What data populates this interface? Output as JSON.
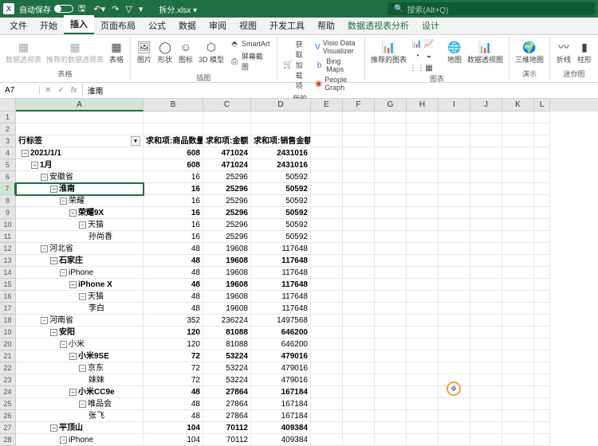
{
  "title_bar": {
    "autosave_label": "自动保存",
    "filename": "拆分.xlsx ▾",
    "search_placeholder": "搜索(Alt+Q)"
  },
  "tabs": [
    "文件",
    "开始",
    "插入",
    "页面布局",
    "公式",
    "数据",
    "审阅",
    "视图",
    "开发工具",
    "帮助",
    "数据透视表分析",
    "设计"
  ],
  "active_tab": "插入",
  "context_tabs": [
    "数据透视表分析",
    "设计"
  ],
  "ribbon": {
    "group_tables": {
      "label": "表格",
      "pivot": "数据透视表",
      "recommend": "推荐的数据透视表",
      "table": "表格"
    },
    "group_illus": {
      "label": "插图",
      "pic": "图片",
      "shapes": "形状",
      "icons": "图标",
      "model": "3D 模型",
      "smartart": "SmartArt",
      "screenshot": "屏幕截图"
    },
    "group_addin": {
      "label": "加载项",
      "get": "获取加载项",
      "my": "我的加载项",
      "visio": "Visio Data Visualizer",
      "bing": "Bing Maps",
      "people": "People Graph"
    },
    "group_charts": {
      "label": "图表",
      "recommend": "推荐的图表",
      "maps": "地图",
      "pivotchart": "数据透视图"
    },
    "group_tour": {
      "label": "演示",
      "map3d": "三维地图"
    },
    "group_spark": {
      "label": "迷你图",
      "line": "折线",
      "col": "柱形"
    }
  },
  "formula_bar": {
    "name_box": "A7",
    "formula": "淮南"
  },
  "columns": [
    "A",
    "B",
    "C",
    "D",
    "E",
    "F",
    "G",
    "H",
    "I",
    "J",
    "K",
    "L"
  ],
  "pivot_headers": {
    "row_label": "行标签",
    "c1": "求和项:商品数量",
    "c2": "求和项:金额",
    "c3": "求和项:销售金额"
  },
  "chart_data": {
    "type": "table",
    "columns": [
      "行标签",
      "求和项:商品数量",
      "求和项:金额",
      "求和项:销售金额"
    ],
    "rows": [
      {
        "label": "2021/1/1",
        "indent": 0,
        "bold": true,
        "v": [
          608,
          471024,
          2431016
        ]
      },
      {
        "label": "1月",
        "indent": 1,
        "bold": true,
        "v": [
          608,
          471024,
          2431016
        ]
      },
      {
        "label": "安徽省",
        "indent": 2,
        "bold": false,
        "v": [
          16,
          25296,
          50592
        ]
      },
      {
        "label": "淮南",
        "indent": 3,
        "bold": true,
        "active": true,
        "v": [
          16,
          25296,
          50592
        ]
      },
      {
        "label": "荣耀",
        "indent": 4,
        "bold": false,
        "v": [
          16,
          25296,
          50592
        ]
      },
      {
        "label": "荣耀9X",
        "indent": 5,
        "bold": true,
        "v": [
          16,
          25296,
          50592
        ]
      },
      {
        "label": "天猫",
        "indent": 6,
        "bold": false,
        "v": [
          16,
          25296,
          50592
        ]
      },
      {
        "label": "孙尚香",
        "indent": 7,
        "bold": false,
        "noexpand": true,
        "v": [
          16,
          25296,
          50592
        ]
      },
      {
        "label": "河北省",
        "indent": 2,
        "bold": false,
        "v": [
          48,
          19608,
          117648
        ]
      },
      {
        "label": "石家庄",
        "indent": 3,
        "bold": true,
        "v": [
          48,
          19608,
          117648
        ]
      },
      {
        "label": "iPhone",
        "indent": 4,
        "bold": false,
        "v": [
          48,
          19608,
          117648
        ]
      },
      {
        "label": "iPhone X",
        "indent": 5,
        "bold": true,
        "v": [
          48,
          19608,
          117648
        ]
      },
      {
        "label": "天猫",
        "indent": 6,
        "bold": false,
        "v": [
          48,
          19608,
          117648
        ]
      },
      {
        "label": "李白",
        "indent": 7,
        "bold": false,
        "noexpand": true,
        "v": [
          48,
          19608,
          117648
        ]
      },
      {
        "label": "河南省",
        "indent": 2,
        "bold": false,
        "v": [
          352,
          236224,
          1497568
        ]
      },
      {
        "label": "安阳",
        "indent": 3,
        "bold": true,
        "v": [
          120,
          81088,
          646200
        ]
      },
      {
        "label": "小米",
        "indent": 4,
        "bold": false,
        "v": [
          120,
          81088,
          646200
        ]
      },
      {
        "label": "小米9SE",
        "indent": 5,
        "bold": true,
        "v": [
          72,
          53224,
          479016
        ]
      },
      {
        "label": "京东",
        "indent": 6,
        "bold": false,
        "v": [
          72,
          53224,
          479016
        ]
      },
      {
        "label": "妹妹",
        "indent": 7,
        "bold": false,
        "noexpand": true,
        "v": [
          72,
          53224,
          479016
        ]
      },
      {
        "label": "小米CC9e",
        "indent": 5,
        "bold": true,
        "v": [
          48,
          27864,
          167184
        ]
      },
      {
        "label": "唯品会",
        "indent": 6,
        "bold": false,
        "v": [
          48,
          27864,
          167184
        ]
      },
      {
        "label": "张飞",
        "indent": 7,
        "bold": false,
        "noexpand": true,
        "v": [
          48,
          27864,
          167184
        ]
      },
      {
        "label": "平顶山",
        "indent": 3,
        "bold": true,
        "v": [
          104,
          70112,
          409384
        ]
      },
      {
        "label": "iPhone",
        "indent": 4,
        "bold": false,
        "v": [
          104,
          70112,
          409384
        ]
      }
    ]
  }
}
